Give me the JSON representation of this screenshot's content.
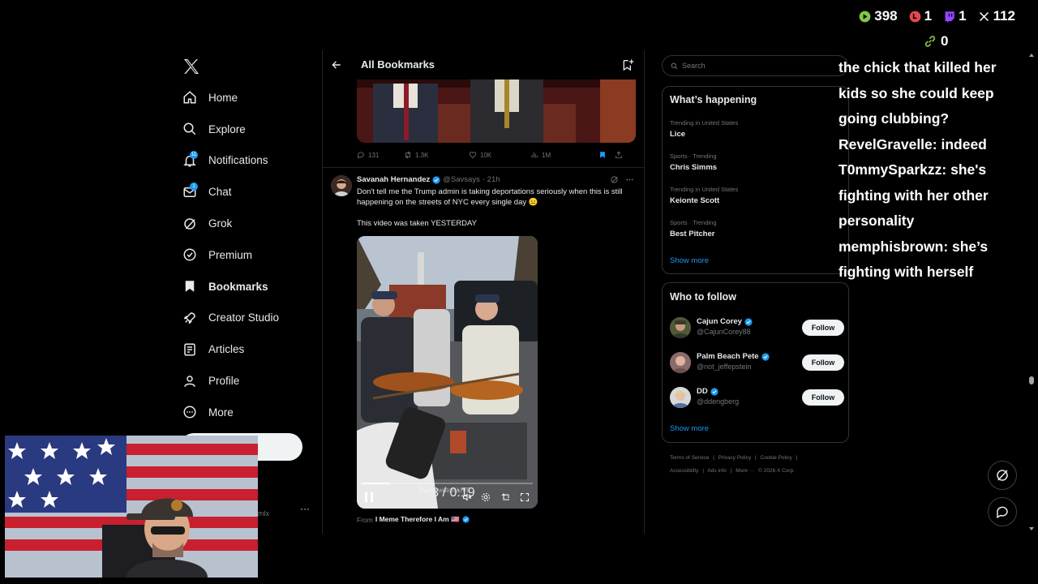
{
  "nav": {
    "items": [
      {
        "label": "Home",
        "icon": "home-icon"
      },
      {
        "label": "Explore",
        "icon": "search-icon"
      },
      {
        "label": "Notifications",
        "icon": "bell-icon",
        "badge": "11"
      },
      {
        "label": "Chat",
        "icon": "mail-icon",
        "badge": "1"
      },
      {
        "label": "Grok",
        "icon": "grok-icon"
      },
      {
        "label": "Premium",
        "icon": "x-premium-icon"
      },
      {
        "label": "Bookmarks",
        "icon": "bookmark-icon",
        "active": true
      },
      {
        "label": "Creator Studio",
        "icon": "rocket-icon"
      },
      {
        "label": "Articles",
        "icon": "article-icon"
      },
      {
        "label": "Profile",
        "icon": "person-icon"
      },
      {
        "label": "More",
        "icon": "more-circle-icon"
      }
    ],
    "account_handle": "mlx",
    "account_more": "···"
  },
  "header": {
    "title": "All Bookmarks"
  },
  "prev_tweet": {
    "replies": "131",
    "retweets": "1.3K",
    "likes": "10K",
    "views": "1M"
  },
  "tweet": {
    "name": "Savanah Hernandez",
    "handle": "@Savsays",
    "time": "· 21h",
    "text": "Don't tell me the Trump admin is taking deportations seriously when this is still happening on the streets of NYC every single day 😐",
    "text2": "This video was taken YESTERDAY",
    "video": {
      "time": "0:03 / 0:19",
      "progress": 0.16,
      "tap_live": "Tap to watch LIVE",
      "watermark": "IMeme0"
    },
    "from_prefix": "From",
    "from_name": "I Meme Therefore I Am 🇺🇸"
  },
  "search": {
    "placeholder": "Search"
  },
  "happening": {
    "title": "What’s happening",
    "trends": [
      {
        "meta": "Trending in United States",
        "name": "Lice"
      },
      {
        "meta": "Sports · Trending",
        "name": "Chris Simms"
      },
      {
        "meta": "Trending in United States",
        "name": "Keionte Scott"
      },
      {
        "meta": "Sports · Trending",
        "name": "Best Pitcher"
      }
    ],
    "show_more": "Show more"
  },
  "who_to_follow": {
    "title": "Who to follow",
    "accounts": [
      {
        "name": "Cajun Corey",
        "handle": "@CajunCorey88",
        "button": "Follow"
      },
      {
        "name": "Palm Beach Pete",
        "handle": "@not_jeffepstein",
        "button": "Follow"
      },
      {
        "name": "DD",
        "handle": "@ddengberg",
        "button": "Follow"
      }
    ],
    "show_more": "Show more"
  },
  "footer": {
    "line1": [
      "Terms of Service",
      "|",
      "Privacy Policy",
      "|",
      "Cookie Policy",
      "|"
    ],
    "line2": [
      "Accessibility",
      "|",
      "Ads info",
      "|",
      "More ···",
      "© 2026 X Corp."
    ]
  },
  "overlay": {
    "stats": [
      {
        "icon": "rumble-icon",
        "value": "398",
        "color": "#85c742"
      },
      {
        "icon": "live-dot-icon",
        "value": "1",
        "color": "#e5484d"
      },
      {
        "icon": "twitch-icon",
        "value": "1",
        "color": "#9146ff"
      },
      {
        "icon": "x-icon",
        "value": "112",
        "color": "#ffffff"
      }
    ],
    "link_value": "0",
    "chat_lines": [
      "the chick that killed her",
      "kids so she could keep",
      "going clubbing?",
      "RevelGravelle: indeed",
      "T0mmySparkzz: she's",
      "fighting with her other",
      "personality",
      "memphisbrown: she’s",
      "fighting with herself"
    ]
  },
  "colors": {
    "accent": "#1d9bf0",
    "background": "#000000",
    "text": "#e7e9ea",
    "muted": "#71767b"
  }
}
